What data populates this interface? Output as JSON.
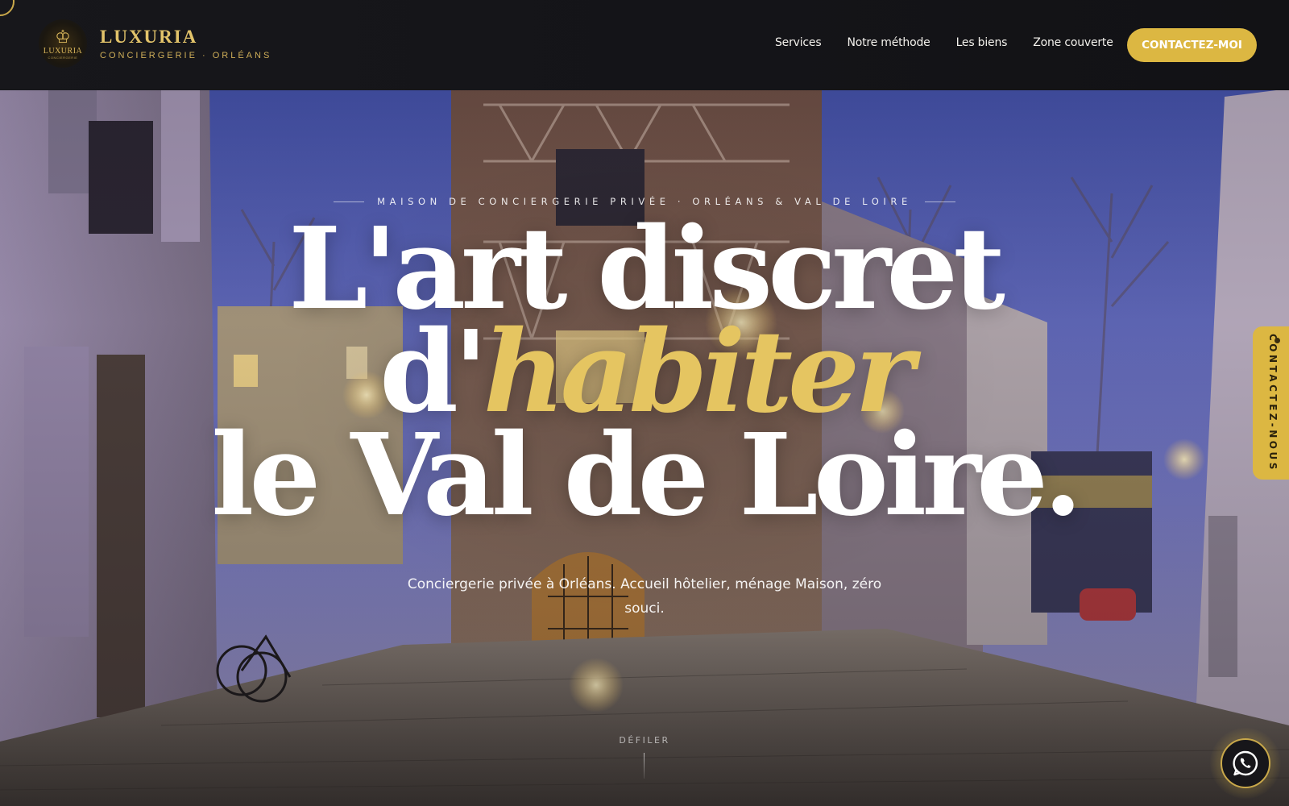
{
  "brand": {
    "name": "LUXURIA",
    "tagline": "CONCIERGERIE · ORLÉANS",
    "emblem_text": "LUXURIA",
    "emblem_subtext": "CONCIERGERIE",
    "accent_color": "#dcb742"
  },
  "nav": {
    "items": [
      {
        "label": "Services"
      },
      {
        "label": "Notre méthode"
      },
      {
        "label": "Les biens"
      },
      {
        "label": "Zone couverte"
      }
    ],
    "cta_label": "CONTACTEZ-MOI"
  },
  "hero": {
    "eyebrow": "MAISON DE CONCIERGERIE PRIVÉE · ORLÉANS & VAL DE LOIRE",
    "headline_line1": "L'art discret",
    "headline_line2_prefix": "d'",
    "headline_line2_accent": "habiter",
    "headline_line3": "le Val de Loire.",
    "subtitle": "Conciergerie privée à Orléans. Accueil hôtelier, ménage Maison, zéro souci.",
    "scroll_label": "DÉFILER"
  },
  "side_tab": {
    "label": "CONTACTEZ-NOUS"
  },
  "floating": {
    "whatsapp_icon": "whatsapp-icon"
  }
}
